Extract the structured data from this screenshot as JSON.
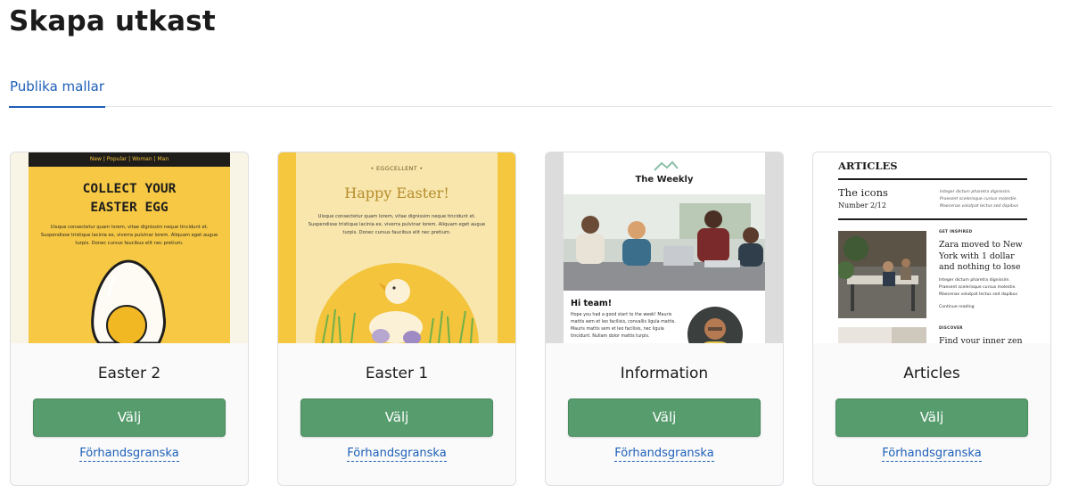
{
  "page": {
    "title": "Skapa utkast"
  },
  "tabs": [
    {
      "label": "Publika mallar",
      "active": true
    }
  ],
  "templates": [
    {
      "name": "Easter 2",
      "choose_label": "Välj",
      "preview_label": "Förhandsgranska",
      "thumb": {
        "nav": "New  |  Popular  |  Woman  |  Man",
        "heading_line1": "COLLECT YOUR",
        "heading_line2": "EASTER EGG",
        "body": "Uisque consectetur quam lorem, vitae dignissim neque tincidunt et. Suspendisse tristique lacinia ex, viverra pulvinar lorem. Aliquam eget augue turpis. Donec cursus faucibus elit nec pretium."
      }
    },
    {
      "name": "Easter 1",
      "choose_label": "Välj",
      "preview_label": "Förhandsgranska",
      "thumb": {
        "logo": "• EGGCELLENT •",
        "title": "Happy Easter!",
        "body": "Uisque consectetur quam lorem, vitae dignissim neque tincidunt et. Suspendisse tristique lacinia ex, viverra pulvinar lorem. Aliquam eget augue turpis. Donec cursus faucibus elit nec pretium."
      }
    },
    {
      "name": "Information",
      "choose_label": "Välj",
      "preview_label": "Förhandsgranska",
      "thumb": {
        "title": "The Weekly",
        "greeting": "Hi team!",
        "body": "Hope you had a good start to the week! Mauris mattis sem et leo facilisis, convallis ligula mattis. Mauris mattis sem et leo facilisis, nec ligula tincidunt. Nullam dolor mattis turpis."
      }
    },
    {
      "name": "Articles",
      "choose_label": "Välj",
      "preview_label": "Förhandsgranska",
      "thumb": {
        "header": "ARTICLES",
        "issue_title": "The icons",
        "issue_number": "Number 2/12",
        "issue_blurb": "Integer dictum pharetra dignissim. Praesent scelerisque cursus molestie. Maecenas volutpat lectus sed dapibus",
        "kicker1": "GET INSPIRED",
        "article1_title": "Zara moved to New York with 1 dollar and nothing to lose",
        "article1_body": "Integer dictum pharetra dignissim. Praesent scelerisque cursus molestie. Maecenas volutpat lectus sed dapibus",
        "article1_link": "Continue reading",
        "kicker2": "DISCOVER",
        "article2_title": "Find your inner zen"
      }
    }
  ]
}
